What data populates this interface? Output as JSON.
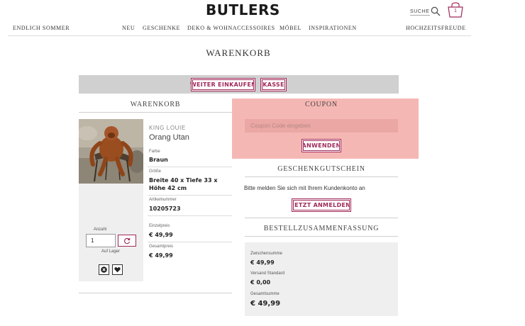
{
  "header": {
    "logo": "BUTLERS",
    "search_label": "SUCHE",
    "cart_count": "1"
  },
  "nav": {
    "left": "ENDLICH SOMMER",
    "items": [
      "NEU",
      "GESCHENKE",
      "DEKO & WOHNACCESSOIRES",
      "MÖBEL",
      "INSPIRATIONEN"
    ],
    "right": "HOCHZEITSFREUDE"
  },
  "page_title": "WARENKORB",
  "actions": {
    "continue_shopping": "WEITER EINKAUFEN",
    "checkout": "KASSE"
  },
  "cart": {
    "section_title": "WARENKORB",
    "item": {
      "brand": "KING LOUIE",
      "name": "Orang Utan",
      "color_label": "Farbe",
      "color_value": "Braun",
      "size_label": "Größe",
      "size_value": "Breite 40 x Tiefe 33 x Höhe 42 cm",
      "sku_label": "Artikelnummer",
      "sku_value": "10205723",
      "unit_price_label": "Einzelpreis",
      "unit_price": "€ 49,99",
      "total_label": "Gesamtpreis",
      "total": "€ 49,99",
      "quantity_label": "Anzahl",
      "quantity": "1",
      "stock_status": "Auf Lager"
    }
  },
  "coupon": {
    "title": "COUPON",
    "placeholder": "Coupon Code eingeben",
    "apply": "ANWENDEN"
  },
  "gift_card": {
    "title": "GESCHENKGUTSCHEIN",
    "text": "Bitte melden Sie sich mit Ihrem Kundenkonto an",
    "login": "JETZT ANMELDEN"
  },
  "summary": {
    "title": "BESTELLZUSAMMENFASSUNG",
    "subtotal_label": "Zwischensumme",
    "subtotal": "€ 49,99",
    "shipping_label": "Versand Standard",
    "shipping": "€ 0,00",
    "total_label": "Gesamtsumme",
    "total": "€ 49,99"
  },
  "colors": {
    "accent": "#a12a5a",
    "coupon_highlight": "#f5b7b3",
    "action_bar": "#d0d0d0"
  }
}
